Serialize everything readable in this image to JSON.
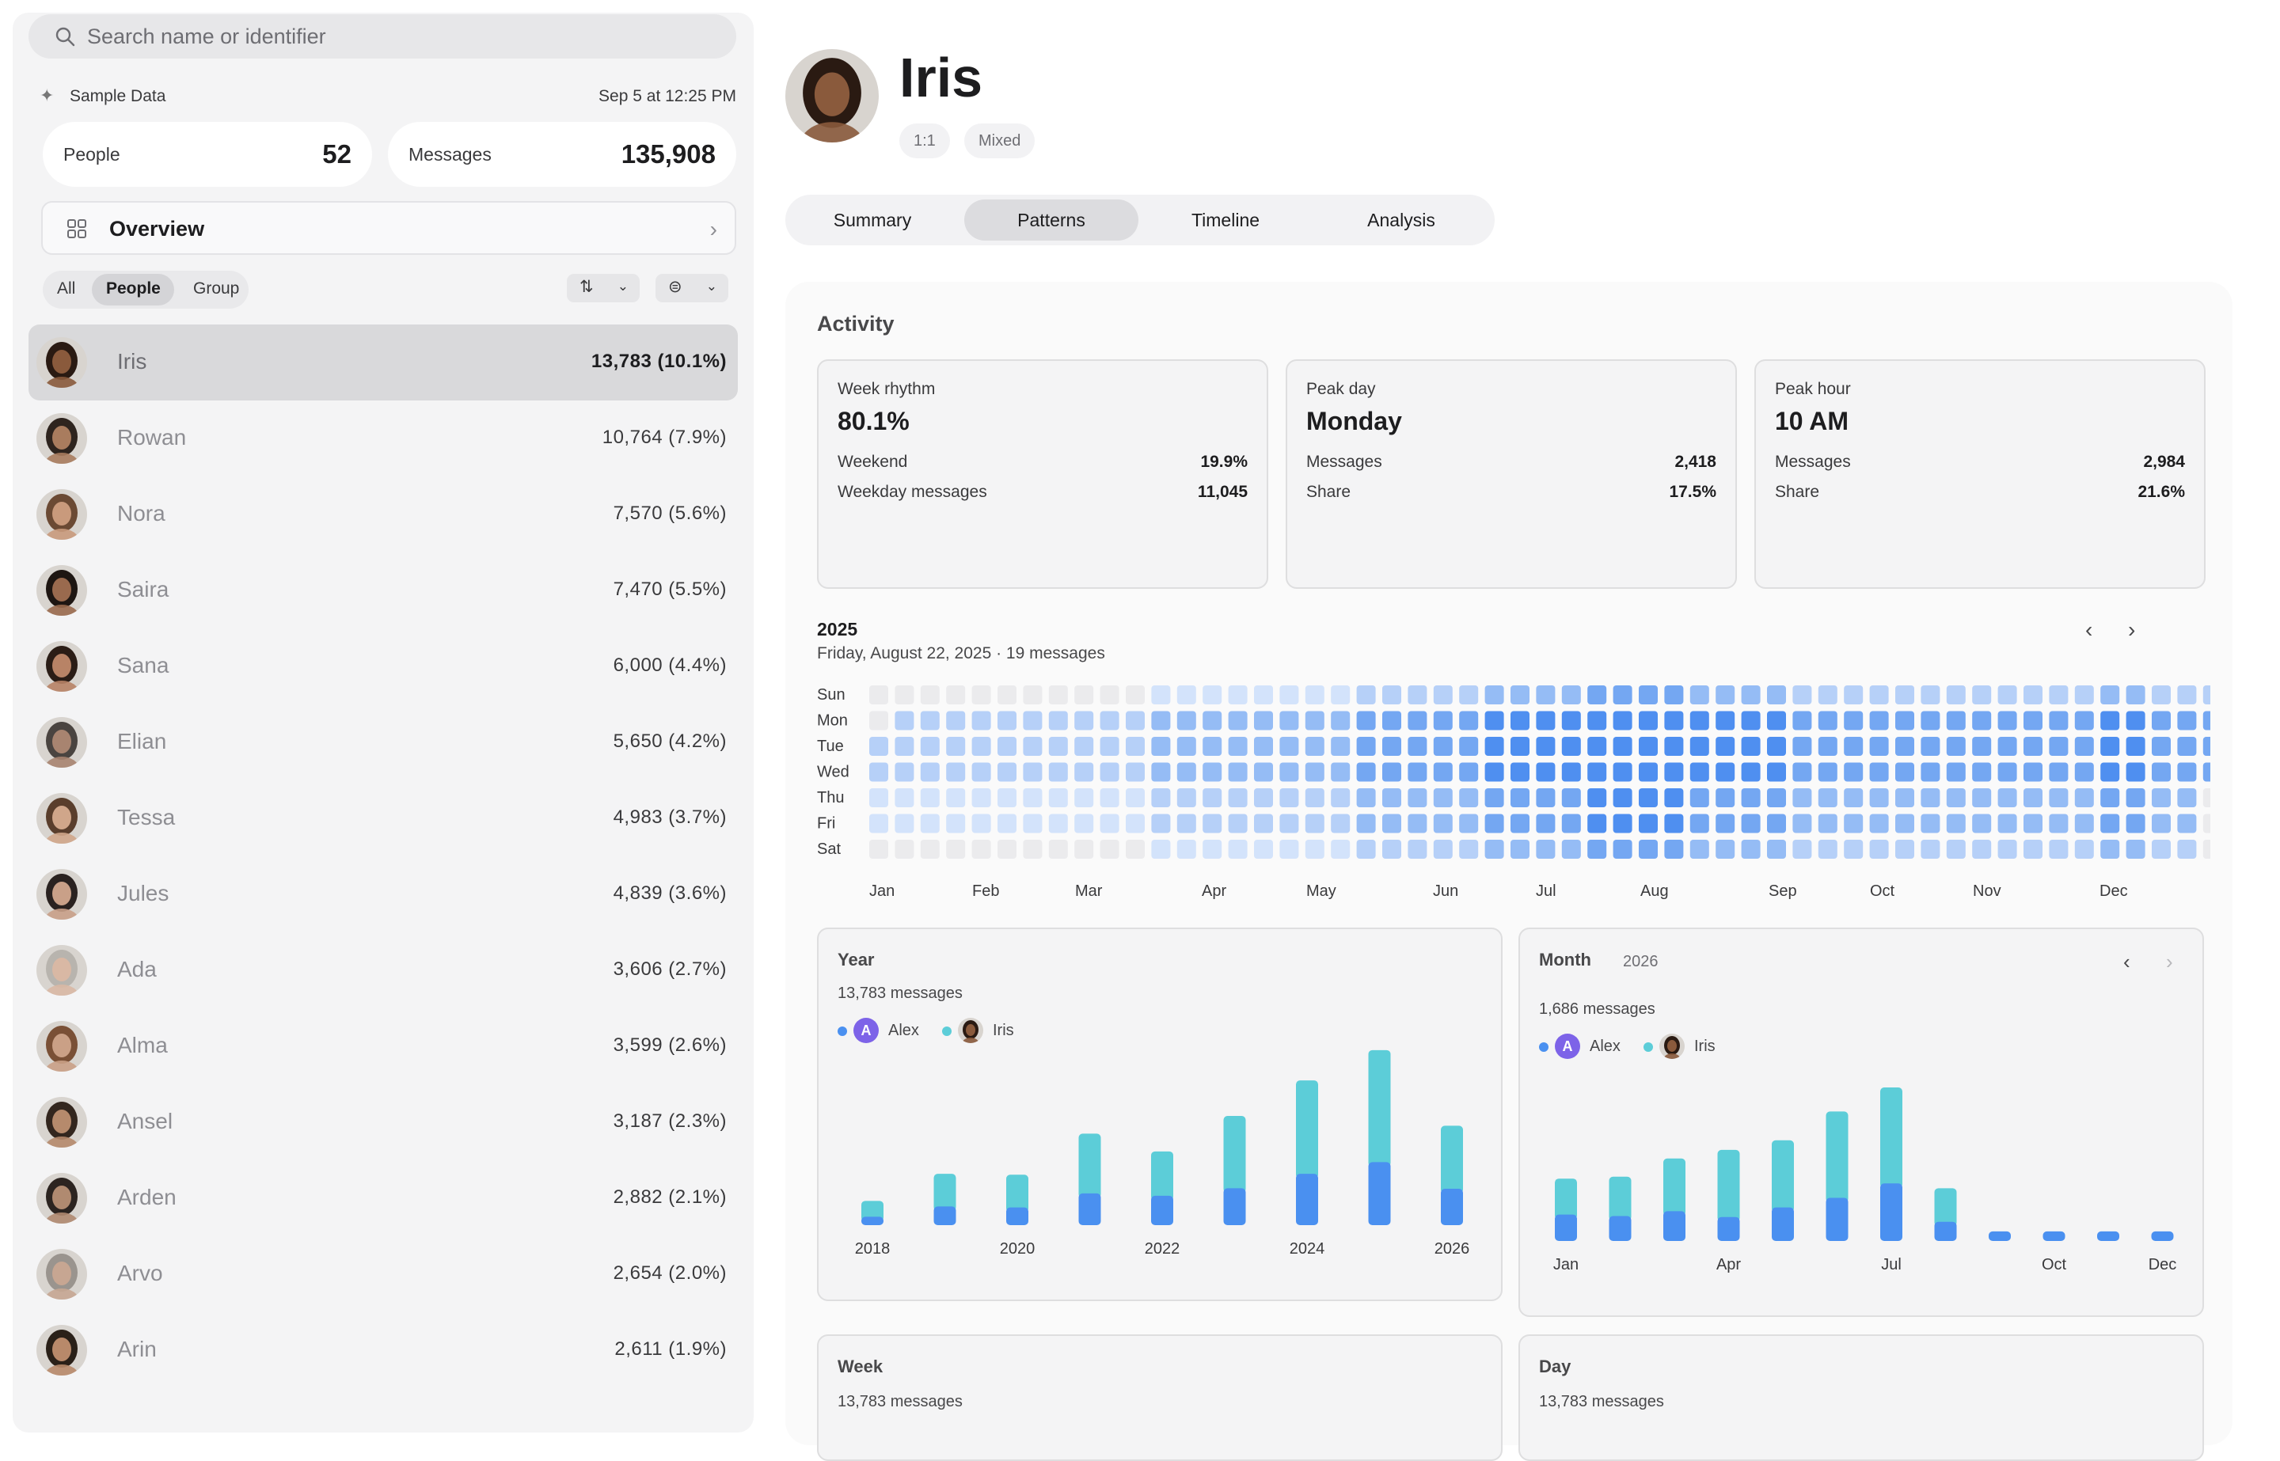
{
  "search": {
    "placeholder": "Search name or identifier"
  },
  "sample": {
    "label": "Sample Data",
    "date": "Sep 5 at 12:25 PM"
  },
  "stats": {
    "people_label": "People",
    "people_value": "52",
    "messages_label": "Messages",
    "messages_value": "135,908"
  },
  "overview": {
    "label": "Overview"
  },
  "filters": {
    "all": "All",
    "people": "People",
    "group": "Group",
    "selected": "People"
  },
  "people": [
    {
      "name": "Iris",
      "count": "13,783 (10.1%)",
      "selected": true,
      "skin": "#8a5a3c",
      "hair": "#2a1a12"
    },
    {
      "name": "Rowan",
      "count": "10,764 (7.9%)",
      "skin": "#a97c5e",
      "hair": "#2e241e"
    },
    {
      "name": "Nora",
      "count": "7,570 (5.6%)",
      "skin": "#c99a7c",
      "hair": "#6b4a34"
    },
    {
      "name": "Saira",
      "count": "7,470 (5.5%)",
      "skin": "#9a6a4e",
      "hair": "#1e1612"
    },
    {
      "name": "Sana",
      "count": "6,000 (4.4%)",
      "skin": "#b88366",
      "hair": "#2b1d16"
    },
    {
      "name": "Elian",
      "count": "5,650 (4.2%)",
      "skin": "#a88470",
      "hair": "#4a4440"
    },
    {
      "name": "Tessa",
      "count": "4,983 (3.7%)",
      "skin": "#d0a68a",
      "hair": "#5a3e2c"
    },
    {
      "name": "Jules",
      "count": "4,839 (3.6%)",
      "skin": "#c9a088",
      "hair": "#2a2220"
    },
    {
      "name": "Ada",
      "count": "3,606 (2.7%)",
      "skin": "#d9b8a4",
      "hair": "#b8b4ae"
    },
    {
      "name": "Alma",
      "count": "3,599 (2.6%)",
      "skin": "#caa086",
      "hair": "#7a5036"
    },
    {
      "name": "Ansel",
      "count": "3,187 (2.3%)",
      "skin": "#b68a6c",
      "hair": "#33261e"
    },
    {
      "name": "Arden",
      "count": "2,882 (2.1%)",
      "skin": "#b08a70",
      "hair": "#2c2420"
    },
    {
      "name": "Arvo",
      "count": "2,654 (2.0%)",
      "skin": "#c7a692",
      "hair": "#9a948e"
    },
    {
      "name": "Arin",
      "count": "2,611 (1.9%)",
      "skin": "#b8896a",
      "hair": "#2a2018"
    }
  ],
  "profile": {
    "name": "Iris",
    "chips": [
      "1:1",
      "Mixed"
    ]
  },
  "tabs": {
    "items": [
      "Summary",
      "Patterns",
      "Timeline",
      "Analysis"
    ],
    "active": "Patterns"
  },
  "activity": {
    "title": "Activity",
    "week_rhythm": {
      "title": "Week rhythm",
      "value": "80.1%",
      "rows": [
        {
          "k": "Weekend",
          "v": "19.9%"
        },
        {
          "k": "Weekday messages",
          "v": "11,045"
        }
      ]
    },
    "peak_day": {
      "title": "Peak day",
      "value": "Monday",
      "rows": [
        {
          "k": "Messages",
          "v": "2,418"
        },
        {
          "k": "Share",
          "v": "17.5%"
        }
      ]
    },
    "peak_hour": {
      "title": "Peak hour",
      "value": "10 AM",
      "rows": [
        {
          "k": "Messages",
          "v": "2,984"
        },
        {
          "k": "Share",
          "v": "21.6%"
        }
      ]
    }
  },
  "heatmap": {
    "year": "2025",
    "subtitle": "Friday, August 22, 2025 · 19 messages",
    "days": [
      "Sun",
      "Mon",
      "Tue",
      "Wed",
      "Thu",
      "Fri",
      "Sat"
    ],
    "months": [
      "Jan",
      "Feb",
      "Mar",
      "Apr",
      "May",
      "Jun",
      "Jul",
      "Aug",
      "Sep",
      "Oct",
      "Nov",
      "Dec"
    ],
    "weekly_level": [
      1,
      1,
      1,
      1,
      1,
      1,
      1,
      1,
      1,
      1,
      1,
      2,
      2,
      2,
      2,
      2,
      2,
      2,
      2,
      3,
      3,
      3,
      3,
      3,
      4,
      4,
      4,
      4,
      5,
      5,
      5,
      5,
      4,
      4,
      4,
      4,
      3,
      3,
      3,
      3,
      3,
      3,
      3,
      3,
      3,
      3,
      3,
      3,
      4,
      4,
      3,
      3,
      3
    ],
    "weekday_boost": [
      -1,
      1,
      1,
      1,
      0,
      0,
      -1
    ],
    "colors": [
      "#ebebed",
      "#d3e3fb",
      "#b6d0f8",
      "#95bcf5",
      "#74a7f2",
      "#4f8ff0"
    ]
  },
  "year_chart": {
    "title": "Year",
    "total": "13,783 messages",
    "legend": [
      "Alex",
      "Iris"
    ],
    "colors": {
      "alex": "#4a90f0",
      "iris": "#5ccdd8"
    },
    "categories": [
      "2018",
      "2019",
      "2020",
      "2021",
      "2022",
      "2023",
      "2024",
      "2025",
      "2026"
    ],
    "tick_labels": [
      "2018",
      "2020",
      "2022",
      "2024",
      "2026"
    ],
    "series": [
      {
        "name": "Alex",
        "values": [
          180,
          400,
          380,
          680,
          630,
          790,
          1100,
          1350,
          780
        ]
      },
      {
        "name": "Iris",
        "values": [
          340,
          700,
          700,
          1280,
          950,
          1550,
          2000,
          2400,
          1350
        ]
      }
    ],
    "ymax": 3900
  },
  "month_chart": {
    "title": "Month",
    "year": "2026",
    "total": "1,686 messages",
    "legend": [
      "Alex",
      "Iris"
    ],
    "categories": [
      "Jan",
      "Feb",
      "Mar",
      "Apr",
      "May",
      "Jun",
      "Jul",
      "Aug",
      "Sep",
      "Oct",
      "Nov",
      "Dec"
    ],
    "tick_labels": [
      "Jan",
      "Apr",
      "Jul",
      "Oct",
      "Dec"
    ],
    "series": [
      {
        "name": "Alex",
        "values": [
          55,
          52,
          62,
          50,
          70,
          90,
          120,
          40,
          20,
          20,
          20,
          20
        ]
      },
      {
        "name": "Iris",
        "values": [
          75,
          82,
          110,
          140,
          140,
          180,
          200,
          70,
          0,
          0,
          0,
          0
        ]
      }
    ],
    "ymax": 330
  },
  "week_card": {
    "title": "Week",
    "total": "13,783 messages"
  },
  "day_card": {
    "title": "Day",
    "total": "13,783 messages"
  }
}
